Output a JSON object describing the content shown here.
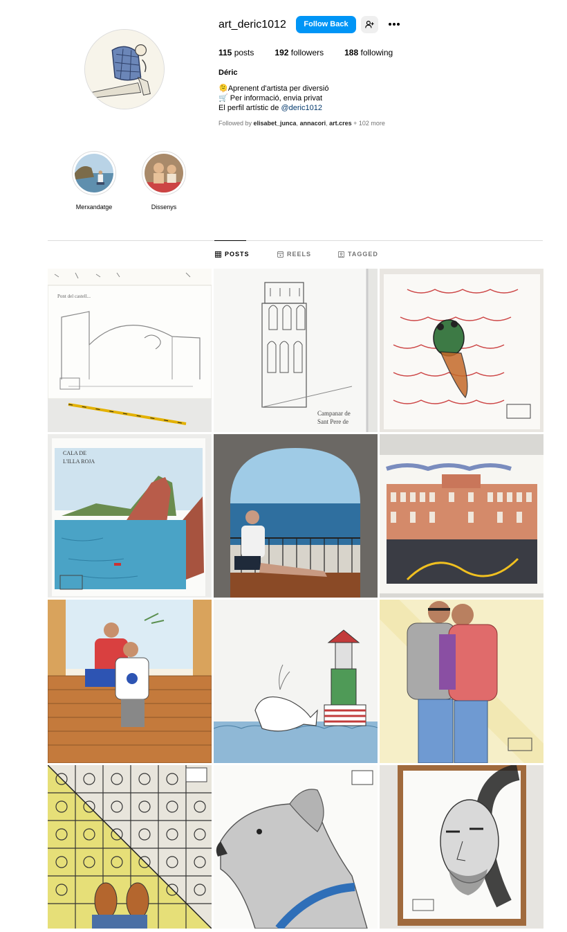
{
  "profile": {
    "username": "art_deric1012",
    "follow_label": "Follow Back",
    "suggest_icon": "person-add-icon",
    "more_icon": "more-horizontal-icon",
    "stats": {
      "posts_count": "115",
      "posts_label": "posts",
      "followers_count": "192",
      "followers_label": "followers",
      "following_count": "188",
      "following_label": "following"
    },
    "full_name": "Déric",
    "bio": {
      "line1": "Aprenent d'artista per diversió",
      "line1_icon": "🫠",
      "line2": " Per informació, envia privat",
      "line2_icon": "🛒",
      "line3_prefix": "El perfil artístic de ",
      "line3_link": "@deric1012"
    },
    "followed_by": {
      "prefix": "Followed by ",
      "user1": "elisabet_junca",
      "sep1": ", ",
      "user2": "annacori",
      "sep2": ", ",
      "user3": "art.cres",
      "suffix": " + 102 more"
    }
  },
  "highlights": [
    {
      "label": "Merxandatge"
    },
    {
      "label": "Dissenys"
    }
  ],
  "tabs": [
    {
      "label": "POSTS",
      "icon": "grid-icon",
      "active": true
    },
    {
      "label": "REELS",
      "icon": "reels-icon",
      "active": false
    },
    {
      "label": "TAGGED",
      "icon": "tagged-icon",
      "active": false
    }
  ],
  "colors": {
    "accent": "#0095f6",
    "link": "#00376b",
    "muted": "#737373",
    "border": "#dbdbdb"
  },
  "posts": [
    {
      "subject": "bridge-pencil-sketch"
    },
    {
      "subject": "bell-tower-sketch"
    },
    {
      "subject": "cicada-on-roof-tiles"
    },
    {
      "subject": "cala-watercolor"
    },
    {
      "subject": "man-in-stone-window-photo"
    },
    {
      "subject": "capitol-building-watercolor"
    },
    {
      "subject": "two-men-on-wall-drawing"
    },
    {
      "subject": "whale-and-lighthouse-drawing"
    },
    {
      "subject": "two-men-hugging-drawing"
    },
    {
      "subject": "floor-tiles-and-shoes-drawing"
    },
    {
      "subject": "dog-profile-drawing"
    },
    {
      "subject": "portrait-ink-framed"
    }
  ]
}
